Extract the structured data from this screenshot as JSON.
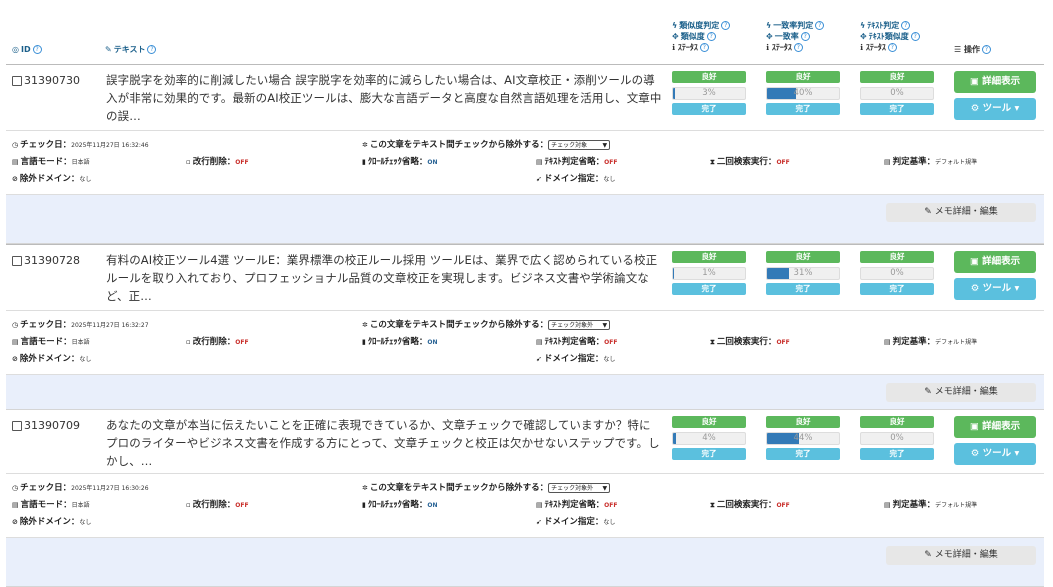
{
  "header": {
    "id_label": "ID",
    "text_label": "テキスト",
    "sim_judge": "類似度判定",
    "sim": "類似度",
    "match_judge": "一致率判定",
    "match": "一致率",
    "textjudge": "ﾃｷｽﾄ判定",
    "textsim": "ﾃｷｽﾄ類似度",
    "status": "ｽﾃｰﾀｽ",
    "op_label": "操作"
  },
  "labels": {
    "good": "良好",
    "done": "完了",
    "detail": "詳細表示",
    "tool": "ツール",
    "memo": "メモ詳細・編集",
    "check_date": "チェック日：",
    "exclude": "この文章をテキスト間チェックから除外する：",
    "lang_mode": "言語モード：",
    "linebreak": "改行削除：",
    "crawl_skip": "ｸﾛｰﾙﾁｪｯｸ省略：",
    "text_skip": "ﾃｷｽﾄ判定省略：",
    "second_search": "二回検索実行：",
    "criteria": "判定基準：",
    "ex_domain": "除外ドメイン：",
    "domain_spec": "ドメイン指定："
  },
  "records": [
    {
      "id": "31390730",
      "text": "誤字脱字を効率的に削減したい場合 誤字脱字を効率的に減らしたい場合は、AI文章校正・添削ツールの導入が非常に効果的です。最新のAI校正ツールは、膨大な言語データと高度な自然言語処理を活用し、文章中の誤…",
      "sim_pct": "3%",
      "sim_val": 3,
      "match_pct": "40%",
      "match_val": 40,
      "text_pct": "0%",
      "text_val": 0,
      "check_date": "2025年11月27日 16:32:46",
      "exclude_select": "チェック対象",
      "lang": "日本語",
      "linebreak": "OFF",
      "crawl_skip": "ON",
      "text_skip": "OFF",
      "second_search": "OFF",
      "criteria": "デフォルト規準",
      "ex_domain": "なし",
      "domain_spec": "なし"
    },
    {
      "id": "31390728",
      "text": "有料のAI校正ツール4選 ツールE：業界標準の校正ルール採用 ツールEは、業界で広く認められている校正ルールを取り入れており、プロフェッショナル品質の文章校正を実現します。ビジネス文書や学術論文など、正…",
      "sim_pct": "1%",
      "sim_val": 1,
      "match_pct": "31%",
      "match_val": 31,
      "text_pct": "0%",
      "text_val": 0,
      "check_date": "2025年11月27日 16:32:27",
      "exclude_select": "チェック対象外",
      "lang": "日本語",
      "linebreak": "OFF",
      "crawl_skip": "ON",
      "text_skip": "OFF",
      "second_search": "OFF",
      "criteria": "デフォルト規準",
      "ex_domain": "なし",
      "domain_spec": "なし"
    },
    {
      "id": "31390709",
      "text": "あなたの文章が本当に伝えたいことを正確に表現できているか、文章チェックで確認していますか？特にプロのライターやビジネス文書を作成する方にとって、文章チェックと校正は欠かせないステップです。しかし、…",
      "sim_pct": "4%",
      "sim_val": 4,
      "match_pct": "44%",
      "match_val": 44,
      "text_pct": "0%",
      "text_val": 0,
      "check_date": "2025年11月27日 16:30:26",
      "exclude_select": "チェック対象外",
      "lang": "日本語",
      "linebreak": "OFF",
      "crawl_skip": "ON",
      "text_skip": "OFF",
      "second_search": "OFF",
      "criteria": "デフォルト規準",
      "ex_domain": "なし",
      "domain_spec": "なし"
    }
  ]
}
